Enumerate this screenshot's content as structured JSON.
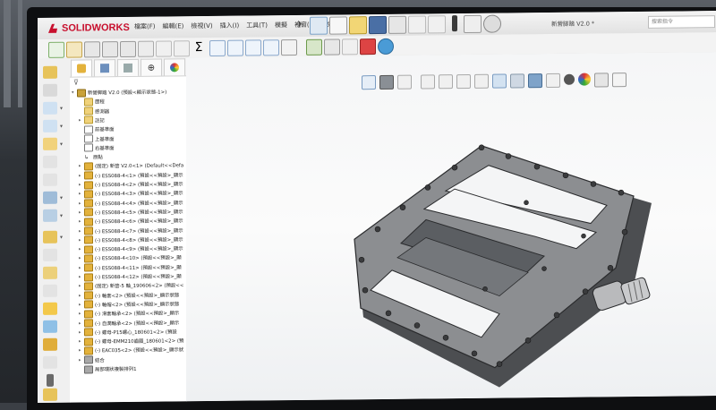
{
  "app": {
    "brand": "SOLIDWORKS",
    "brand_color": "#c8102e",
    "document_title": "新营脚踏 V2.0 *",
    "search_placeholder": "搜索指令"
  },
  "menu": [
    "檔案(F)",
    "編輯(E)",
    "檢視(V)",
    "插入(I)",
    "工具(T)",
    "模擬",
    "視窗(W)",
    "說明(H)"
  ],
  "feature_tree": {
    "filter_icon": "filter-icon",
    "tabs": [
      "feature-manager",
      "property-manager",
      "configuration-manager",
      "dimxpert",
      "display-manager"
    ],
    "items": [
      {
        "label": "新營脚踏 V2.0 (預設<顯示狀態-1>)",
        "icon": "assembly",
        "level": 0,
        "expand": "▾"
      },
      {
        "label": "歷程",
        "icon": "folder",
        "level": 1,
        "expand": ""
      },
      {
        "label": "感測器",
        "icon": "folder",
        "level": 1,
        "expand": ""
      },
      {
        "label": "註記",
        "icon": "folder",
        "level": 1,
        "expand": "▸"
      },
      {
        "label": "前基準面",
        "icon": "plane",
        "level": 1,
        "expand": ""
      },
      {
        "label": "上基準面",
        "icon": "plane",
        "level": 1,
        "expand": ""
      },
      {
        "label": "右基準面",
        "icon": "plane",
        "level": 1,
        "expand": ""
      },
      {
        "label": "原點",
        "icon": "origin",
        "level": 1,
        "expand": ""
      },
      {
        "label": "(固定) 新营 V2.0<1> (Default<<Defa",
        "icon": "part",
        "level": 1,
        "expand": "▸"
      },
      {
        "label": "(-) ESS088-4<1> (預設<<預設>_顯示",
        "icon": "part",
        "level": 1,
        "expand": "▸"
      },
      {
        "label": "(-) ESS088-4<2> (預設<<預設>_顯示",
        "icon": "part",
        "level": 1,
        "expand": "▸"
      },
      {
        "label": "(-) ESS088-4<3> (預設<<預設>_顯示",
        "icon": "part",
        "level": 1,
        "expand": "▸"
      },
      {
        "label": "(-) ESS088-4<4> (預設<<預設>_顯示",
        "icon": "part",
        "level": 1,
        "expand": "▸"
      },
      {
        "label": "(-) ESS088-4<5> (預設<<預設>_顯示",
        "icon": "part",
        "level": 1,
        "expand": "▸"
      },
      {
        "label": "(-) ESS088-4<6> (預設<<預設>_顯示",
        "icon": "part",
        "level": 1,
        "expand": "▸"
      },
      {
        "label": "(-) ESS088-4<7> (預設<<預設>_顯示",
        "icon": "part",
        "level": 1,
        "expand": "▸"
      },
      {
        "label": "(-) ESS088-4<8> (預設<<預設>_顯示",
        "icon": "part",
        "level": 1,
        "expand": "▸"
      },
      {
        "label": "(-) ESS088-4<9> (預設<<預設>_顯示",
        "icon": "part",
        "level": 1,
        "expand": "▸"
      },
      {
        "label": "(-) ESS088-4<10> (預設<<預設>_顯",
        "icon": "part",
        "level": 1,
        "expand": "▸"
      },
      {
        "label": "(-) ESS088-4<11> (預設<<預設>_顯",
        "icon": "part",
        "level": 1,
        "expand": "▸"
      },
      {
        "label": "(-) ESS088-4<12> (預設<<預設>_顯",
        "icon": "part",
        "level": 1,
        "expand": "▸"
      },
      {
        "label": "(固定) 新营-5 軸_190606<2> (預設<<",
        "icon": "part",
        "level": 1,
        "expand": "▸"
      },
      {
        "label": "(-) 軸套<2> (預設<<預設>_顯示狀態",
        "icon": "part",
        "level": 1,
        "expand": "▸"
      },
      {
        "label": "(-) 軸帽<2> (預設<<預設>_顯示狀態",
        "icon": "part",
        "level": 1,
        "expand": "▸"
      },
      {
        "label": "(-) 滑套軸承<2> (預設<<預設>_顯示",
        "icon": "part",
        "level": 1,
        "expand": "▸"
      },
      {
        "label": "(-) 自潤軸承<2> (預設<<預設>_顯示",
        "icon": "part",
        "level": 1,
        "expand": "▸"
      },
      {
        "label": "(-) 螺母-P15螺心_180601<2> (預設",
        "icon": "part",
        "level": 1,
        "expand": "▸"
      },
      {
        "label": "(-) 螺母-EMM210齒圈_180601<2> (預",
        "icon": "part",
        "level": 1,
        "expand": "▸"
      },
      {
        "label": "(-) EAC035<2> (預設<<預設>_顯示狀",
        "icon": "part",
        "level": 1,
        "expand": "▸"
      },
      {
        "label": "結合",
        "icon": "mate",
        "level": 1,
        "expand": "▸"
      },
      {
        "label": "局部環狀複製排列1",
        "icon": "mate",
        "level": 1,
        "expand": ""
      }
    ]
  },
  "colors": {
    "part_icon": "#e3b23c",
    "model_body": "#8c8e91",
    "model_shadow": "#4c4e51",
    "model_edge": "#2a2b2d",
    "spindle": "#b9babc"
  }
}
